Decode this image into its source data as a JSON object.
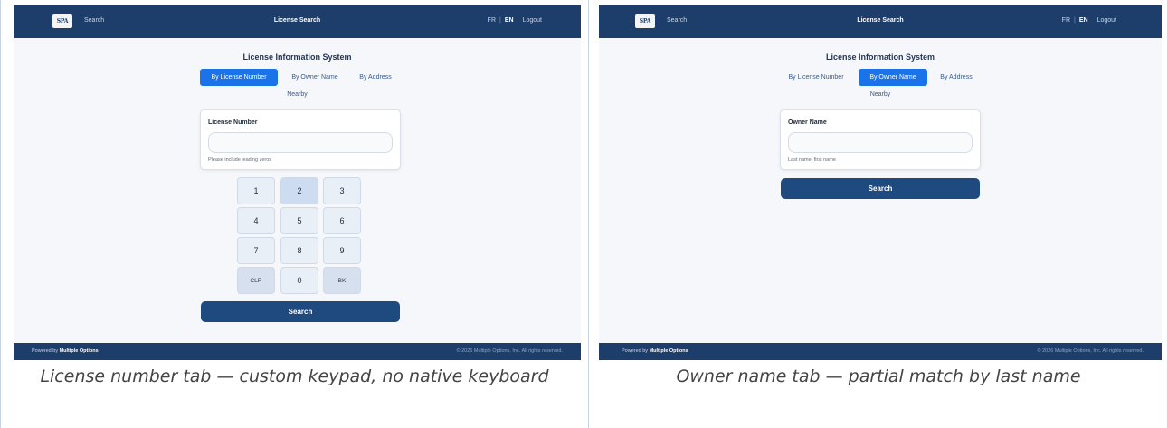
{
  "screens": [
    {
      "header": {
        "logo_text": "SPA",
        "search_link": "Search",
        "title": "License Search",
        "lang_fr": "FR",
        "lang_sep": "|",
        "lang_en": "EN",
        "logout": "Logout"
      },
      "system_title": "License Information System",
      "tabs": [
        {
          "label": "By License Number",
          "active": true
        },
        {
          "label": "By Owner Name",
          "active": false
        },
        {
          "label": "By Address",
          "active": false
        },
        {
          "label": "Nearby",
          "active": false
        }
      ],
      "field": {
        "label": "License Number",
        "value": "",
        "placeholder": "",
        "hint": "Please include leading zeros"
      },
      "keypad": {
        "keys": [
          "1",
          "2",
          "3",
          "4",
          "5",
          "6",
          "7",
          "8",
          "9",
          "CLR",
          "0",
          "BK"
        ],
        "highlighted_key": "2"
      },
      "search_button": "Search",
      "footer": {
        "powered_prefix": "Powered by",
        "powered_brand": "Multiple Options",
        "copyright": "© 2026 Multiple Options, Inc. All rights reserved."
      },
      "caption": "License number tab — custom keypad, no native keyboard"
    },
    {
      "header": {
        "logo_text": "SPA",
        "search_link": "Search",
        "title": "License Search",
        "lang_fr": "FR",
        "lang_sep": "|",
        "lang_en": "EN",
        "logout": "Logout"
      },
      "system_title": "License Information System",
      "tabs": [
        {
          "label": "By License Number",
          "active": false
        },
        {
          "label": "By Owner Name",
          "active": true
        },
        {
          "label": "By Address",
          "active": false
        },
        {
          "label": "Nearby",
          "active": false
        }
      ],
      "field": {
        "label": "Owner Name",
        "value": "",
        "placeholder": "",
        "hint": "Last name, first name"
      },
      "search_button": "Search",
      "footer": {
        "powered_prefix": "Powered by",
        "powered_brand": "Multiple Options",
        "copyright": "© 2026 Multiple Options, Inc. All rights reserved."
      },
      "caption": "Owner name tab — partial match by last name"
    }
  ],
  "colors": {
    "header_bg": "#1d3d6b",
    "page_bg": "#f5f7fa",
    "active_tab": "#1a73e8",
    "search_button": "#1f4a80",
    "keypad_key": "#e9eff7"
  }
}
